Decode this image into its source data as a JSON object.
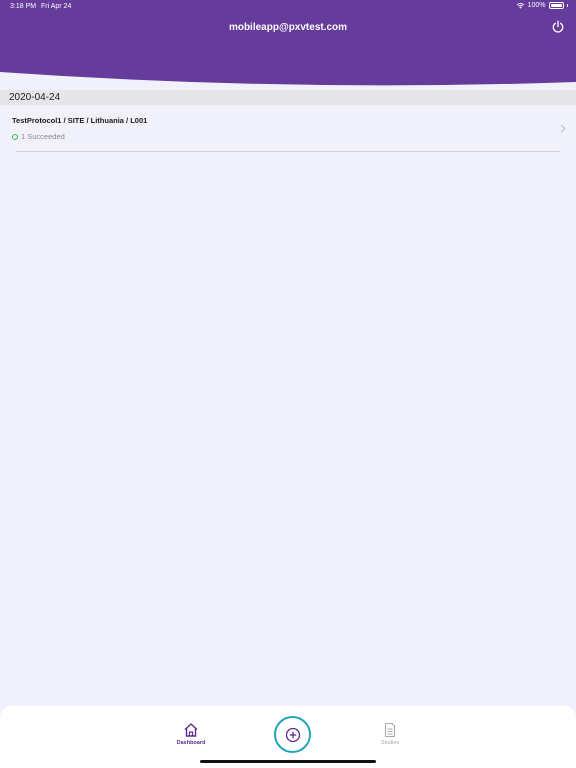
{
  "status_bar": {
    "time": "3:18 PM",
    "date": "Fri Apr 24",
    "battery": "100%",
    "wifi_icon": "wifi-icon",
    "battery_icon": "battery-icon"
  },
  "header": {
    "email": "mobileapp@pxvtest.com",
    "power_icon": "power-icon",
    "background_color": "#653b9c"
  },
  "sections": [
    {
      "date": "2020-04-24",
      "items": [
        {
          "title": "TestProtocol1 / SITE / Lithuania / L001",
          "status": "1 Succeeded",
          "status_color": "#3cba4b"
        }
      ]
    }
  ],
  "tabbar": {
    "dashboard_label": "Dashboard",
    "studies_label": "Studies",
    "active_color": "#5a2d90",
    "add_button_color": "#21a5b7"
  }
}
